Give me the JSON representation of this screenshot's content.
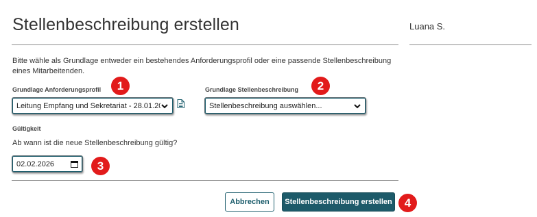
{
  "header": {
    "title": "Stellenbeschreibung erstellen",
    "user": "Luana S."
  },
  "form": {
    "intro": "Bitte wähle als Grundlage entweder ein bestehendes Anforderungsprofil oder eine passende Stellenbeschreibung eines Mitarbeitenden.",
    "profil_label": "Grundlage Anforderungsprofil",
    "profil_value": "Leitung Empfang und Sekretariat - 28.01.20",
    "stelle_label": "Grundlage Stellenbeschreibung",
    "stelle_value": "Stellenbeschreibung auswählen...",
    "gueltig_label": "Gültigkeit",
    "gueltig_question": "Ab wann ist die neue Stellenbeschreibung gültig?",
    "date_value": "02.02.2026"
  },
  "actions": {
    "cancel_label": "Abbrechen",
    "create_label": "Stellenbeschreibung erstellen"
  },
  "markers": [
    "1",
    "2",
    "3",
    "4"
  ],
  "icons": {
    "dropdown": "chevron-down-icon",
    "document": "document-icon",
    "calendar": "calendar-icon"
  },
  "colors": {
    "primary": "#1d5a69",
    "marker": "#e21b1b"
  }
}
